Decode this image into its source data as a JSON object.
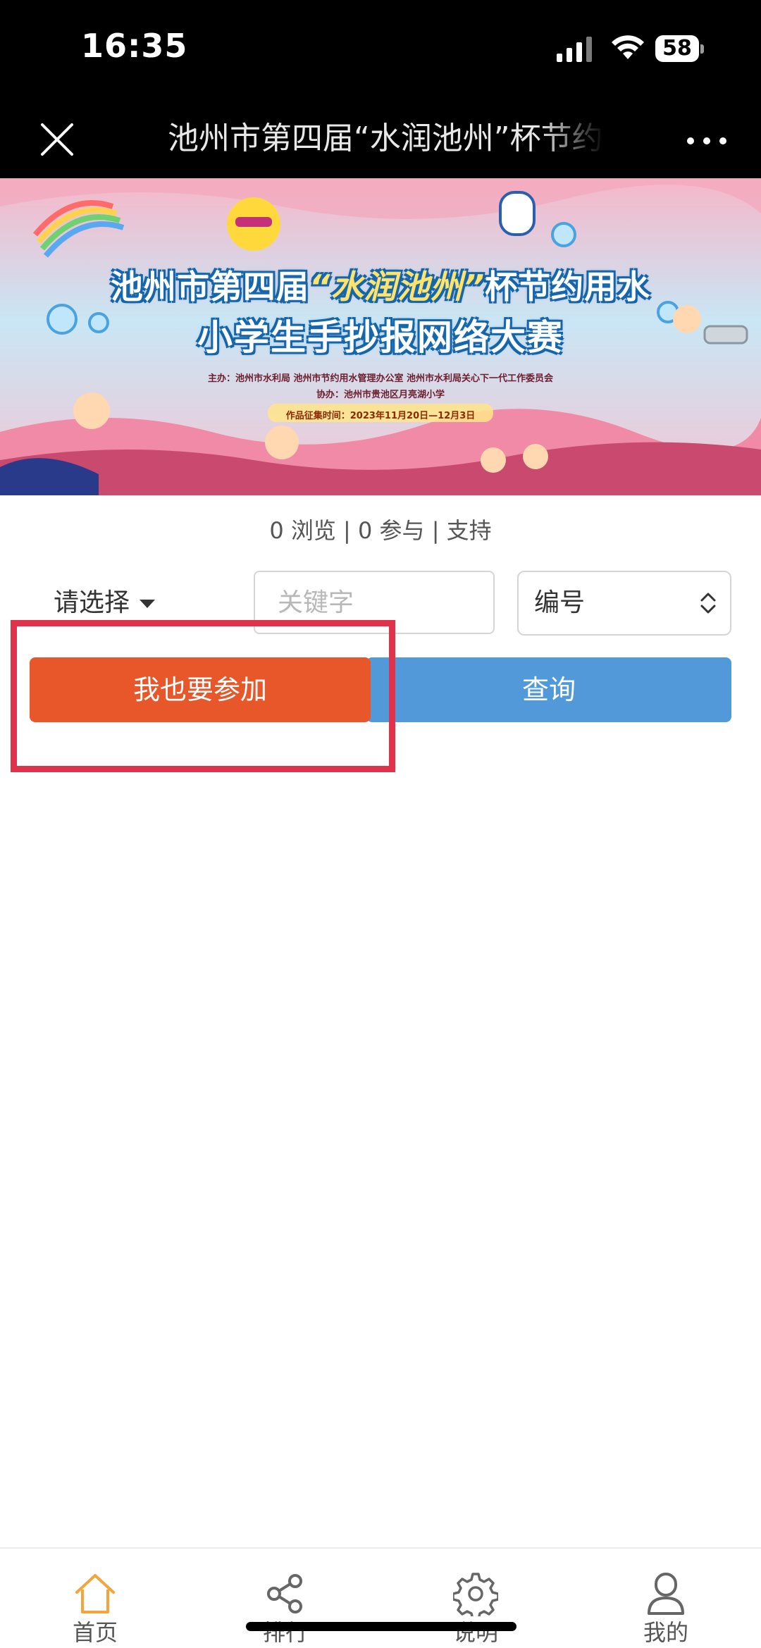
{
  "status_bar": {
    "time": "16:35",
    "battery": "58",
    "icons": [
      "signal-icon",
      "wifi-icon",
      "battery-icon"
    ]
  },
  "title_bar": {
    "title": "池州市第四届“水润池州”杯节约用水小学生手抄报网络大赛",
    "close_icon": "close-icon",
    "more_icon": "more-icon"
  },
  "banner": {
    "title_line1_pre": "池州市第四届",
    "title_line1_highlight": "“水润池州”",
    "title_line1_post": "杯节约用水",
    "title_line2": "小学生手抄报网络大赛",
    "host": "主办：池州市水利局  池州市节约用水管理办公室  池州市水利局关心下一代工作委员会",
    "co_host": "协办：池州市贵池区月亮湖小学",
    "collection_time": "作品征集时间：2023年11月20日—12月3日"
  },
  "stats": {
    "views": "0 浏览",
    "participants": "0 参与",
    "support": "支持",
    "sep": " | "
  },
  "search": {
    "category_label": "请选择",
    "keyword_placeholder": "关键字",
    "sort_value": "编号"
  },
  "actions": {
    "join_label": "我也要参加",
    "query_label": "查询"
  },
  "tabbar": {
    "items": [
      {
        "label": "首页",
        "icon": "home-icon"
      },
      {
        "label": "排行",
        "icon": "share-icon"
      },
      {
        "label": "说明",
        "icon": "gear-icon"
      },
      {
        "label": "我的",
        "icon": "user-icon"
      }
    ]
  },
  "colors": {
    "join_button": "#e8572a",
    "query_button": "#5199d9",
    "highlight_frame": "#e0324a",
    "home_tab_active": "#f3a53c"
  }
}
